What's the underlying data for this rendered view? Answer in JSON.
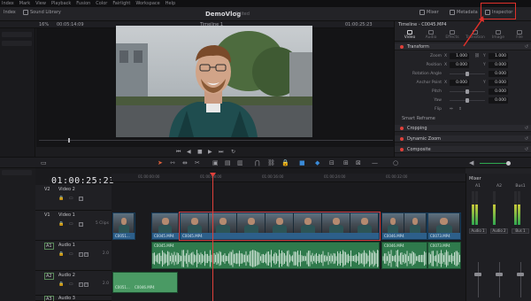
{
  "menu": [
    "Index",
    "Mark",
    "View",
    "Playback",
    "Fusion",
    "Color",
    "Fairlight",
    "Workspace",
    "Help"
  ],
  "toolbar": {
    "index_label": "Index",
    "sound_library_label": "Sound Library",
    "project_title": "DemoVlog",
    "project_status": "Edited",
    "mixer_label": "Mixer",
    "metadata_label": "Metadata",
    "inspector_label": "Inspector"
  },
  "viewer": {
    "zoom": "16%",
    "source_timecode": "00:05:14:09",
    "timeline_name": "Timeline 1",
    "record_timecode": "01:00:25:23"
  },
  "inspector": {
    "clip_title": "Timeline - C0045.MP4",
    "tabs": [
      "Video",
      "Audio",
      "Effects",
      "Transition",
      "Image",
      "File"
    ],
    "active_tab": "Video",
    "sections": {
      "transform": "Transform",
      "smart_reframe": "Smart Reframe",
      "cropping": "Cropping",
      "dynamic_zoom": "Dynamic Zoom",
      "composite": "Composite"
    },
    "params": {
      "zoom_label": "Zoom",
      "zoom_x": "1.000",
      "zoom_y": "1.000",
      "position_label": "Position",
      "position_x": "0.000",
      "position_y": "0.000",
      "rotation_label": "Rotation Angle",
      "rotation_value": "0.000",
      "anchor_label": "Anchor Point",
      "anchor_x": "0.000",
      "anchor_y": "0.000",
      "pitch_label": "Pitch",
      "pitch_value": "0.000",
      "yaw_label": "Yaw",
      "yaw_value": "0.000",
      "flip_label": "Flip",
      "x_axis": "X",
      "y_axis": "Y"
    }
  },
  "timeline": {
    "timecode": "01:00:25:23",
    "ruler_marks": [
      "01:00:00:00",
      "01:00:08:00",
      "01:00:16:00",
      "01:00:24:00",
      "01:00:32:00"
    ],
    "tracks": [
      {
        "id": "V2",
        "name": "Video 2",
        "count": ""
      },
      {
        "id": "V1",
        "name": "Video 1",
        "count": "5 Clips"
      },
      {
        "id": "A1",
        "name": "Audio 1",
        "count": "2.0"
      },
      {
        "id": "A2",
        "name": "Audio 2",
        "count": "2.0"
      },
      {
        "id": "A3",
        "name": "Audio 3",
        "count": ""
      }
    ],
    "video_clips": [
      "C0051...",
      "C0045.MP4",
      "C0045.MP4",
      "C0046.MP4",
      "C0073.MP4"
    ],
    "audio_clips": [
      "C0045.MP4",
      "C0046.MP4",
      "C0073.MP4",
      "C0051...",
      "C0046.MP4"
    ]
  },
  "mixer": {
    "title": "Mixer",
    "channels": [
      "A1",
      "A2",
      "Bus1"
    ],
    "badges": [
      "Audio 1",
      "Audio 2",
      "Bus 1"
    ]
  },
  "colors": {
    "accent_red": "#e0403a",
    "video_clip": "#2d5f8a",
    "audio_clip": "#2f7a4c"
  }
}
